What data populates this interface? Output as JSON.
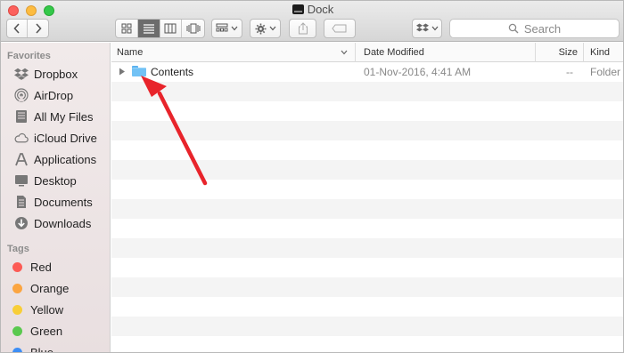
{
  "window": {
    "title": "Dock",
    "controls": [
      "close",
      "minimize",
      "zoom"
    ]
  },
  "toolbar": {
    "back_icon": "chevron-left-icon",
    "forward_icon": "chevron-right-icon",
    "view_modes": [
      "icon-view-icon",
      "list-view-icon",
      "column-view-icon",
      "cover-flow-icon"
    ],
    "active_view": "list-view-icon",
    "arrange_icon": "arrange-icon",
    "action_icon": "gear-icon",
    "share_icon": "share-icon",
    "tags_icon": "tag-icon",
    "dropbox_icon": "dropbox-icon",
    "search_placeholder": "Search"
  },
  "sidebar": {
    "favorites_label": "Favorites",
    "favorites": [
      {
        "label": "Dropbox",
        "icon": "dropbox-icon"
      },
      {
        "label": "AirDrop",
        "icon": "airdrop-icon"
      },
      {
        "label": "All My Files",
        "icon": "all-files-icon"
      },
      {
        "label": "iCloud Drive",
        "icon": "cloud-icon"
      },
      {
        "label": "Applications",
        "icon": "applications-icon"
      },
      {
        "label": "Desktop",
        "icon": "desktop-icon"
      },
      {
        "label": "Documents",
        "icon": "documents-icon"
      },
      {
        "label": "Downloads",
        "icon": "downloads-icon"
      }
    ],
    "tags_label": "Tags",
    "tags": [
      {
        "label": "Red",
        "color": "#fc5b55"
      },
      {
        "label": "Orange",
        "color": "#fba541"
      },
      {
        "label": "Yellow",
        "color": "#f8ce38"
      },
      {
        "label": "Green",
        "color": "#5ac94f"
      },
      {
        "label": "Blue",
        "color": "#3d8ef5"
      }
    ]
  },
  "list": {
    "columns": [
      "Name",
      "Date Modified",
      "Size",
      "Kind"
    ],
    "sort_indicator": "chevron-down-icon",
    "rows": [
      {
        "name": "Contents",
        "date_modified": "01-Nov-2016, 4:41 AM",
        "size": "--",
        "kind": "Folder",
        "icon": "folder-icon"
      }
    ]
  },
  "annotation": {
    "arrow_color": "#e8242b",
    "arrow_icon": "red-arrow"
  }
}
